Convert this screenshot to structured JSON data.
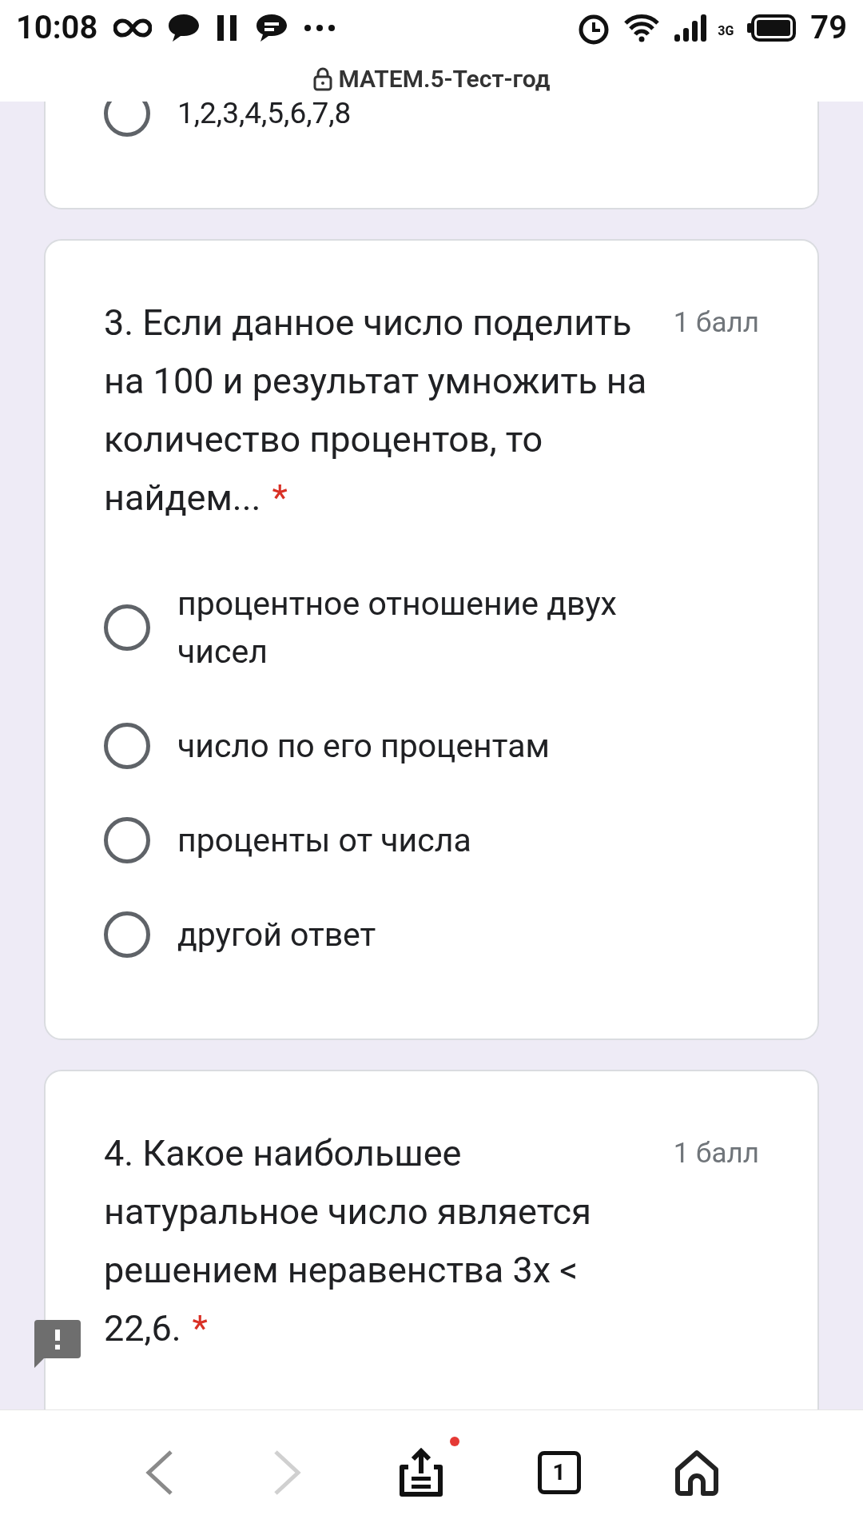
{
  "status_bar": {
    "time": "10:08",
    "network": "3G",
    "battery": "79"
  },
  "address_bar": {
    "title": "МАТЕМ.5-Тест-год"
  },
  "questions": [
    {
      "kind": "partial",
      "options": [
        {
          "label": "1,2,3,4,5,6,7,8",
          "selected": false
        }
      ]
    },
    {
      "kind": "question",
      "title": "3. Если данное число поделить на 100 и результат умножить на количество процентов, то найдем...",
      "required_mark": "*",
      "points": "1 балл",
      "options": [
        {
          "label": "процентное отношение двух чисел",
          "selected": false
        },
        {
          "label": "число по его процентам",
          "selected": false
        },
        {
          "label": "проценты от числа",
          "selected": false
        },
        {
          "label": "другой ответ",
          "selected": false
        }
      ]
    },
    {
      "kind": "question",
      "title": "4. Какое наибольшее натуральное число является решением неравенства 3x < 22,6.",
      "required_mark": "*",
      "points": "1 балл"
    }
  ],
  "nav": {
    "tab_count": "1",
    "back_enabled": true,
    "forward_enabled": false,
    "share_badge": true
  }
}
